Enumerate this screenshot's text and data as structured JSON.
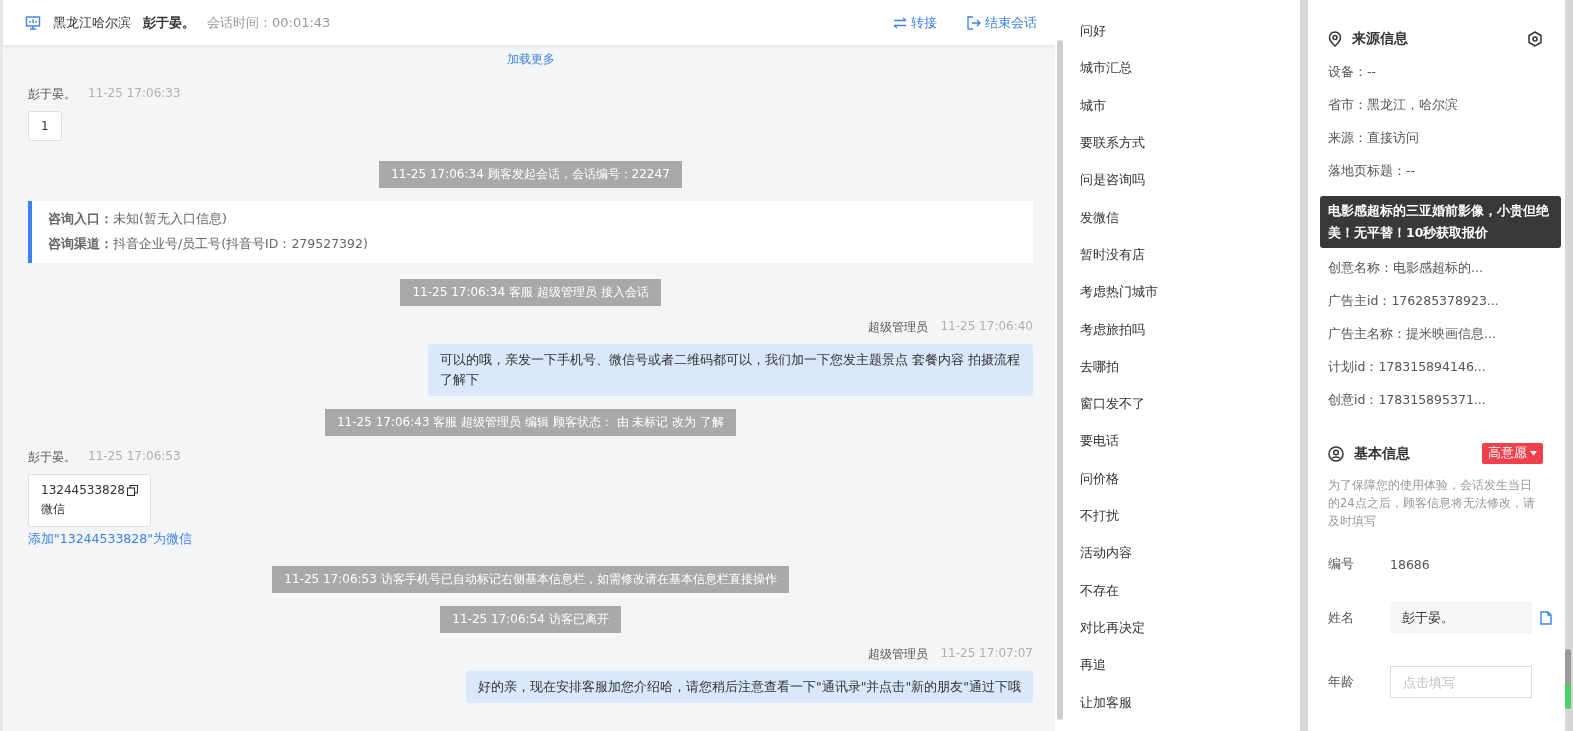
{
  "header": {
    "location": "黑龙江哈尔滨",
    "name": "彭于晏。",
    "duration_label": "会话时间：",
    "duration": "00:01:43",
    "actions": [
      {
        "kind": "transfer",
        "label": "转接"
      },
      {
        "kind": "end",
        "label": "结束会话"
      }
    ]
  },
  "chat": [
    {
      "kind": "load_more",
      "text": "加载更多"
    },
    {
      "kind": "visitor",
      "sender": "彭于晏。",
      "time": "11-25 17:06:33",
      "text": "1"
    },
    {
      "kind": "system",
      "text": "11-25 17:06:34 顾客发起会话，会话编号：22247"
    },
    {
      "kind": "info",
      "lines": [
        {
          "label": "咨询入口：",
          "value": "未知(暂无入口信息)"
        },
        {
          "label": "咨询渠道：",
          "value": "抖音企业号/员工号(抖音号ID：279527392)"
        }
      ]
    },
    {
      "kind": "system",
      "text": "11-25 17:06:34 客服 超级管理员 接入会话"
    },
    {
      "kind": "agent",
      "sender": "超级管理员",
      "time": "11-25 17:06:40",
      "text": "可以的哦，亲发一下手机号、微信号或者二维码都可以，我们加一下您发主题景点 套餐内容 拍摄流程了解下"
    },
    {
      "kind": "system",
      "text": "11-25 17:06:43 客服 超级管理员 编辑 顾客状态： 由 未标记 改为 了解"
    },
    {
      "kind": "contact",
      "sender": "彭于晏。",
      "time": "11-25 17:06:53",
      "phone": "13244533828",
      "type": "微信",
      "link": "添加\"13244533828\"为微信"
    },
    {
      "kind": "system",
      "text": "11-25 17:06:53 访客手机号已自动标记右侧基本信息栏，如需修改请在基本信息栏直接操作"
    },
    {
      "kind": "system",
      "text": "11-25 17:06:54 访客已离开"
    },
    {
      "kind": "agent",
      "sender": "超级管理员",
      "time": "11-25 17:07:07",
      "text": "好的亲，现在安排客服加您介绍哈，请您稍后注意查看一下\"通讯录\"并点击\"新的朋友\"通过下哦"
    }
  ],
  "quick_replies": [
    "问好",
    "城市汇总",
    "城市",
    "要联系方式",
    "问是咨询吗",
    "发微信",
    "暂时没有店",
    "考虑热门城市",
    "考虑旅拍吗",
    "去哪拍",
    "窗口发不了",
    "要电话",
    "问价格",
    "不打扰",
    "活动内容",
    "不存在",
    "对比再决定",
    "再追",
    "让加客服"
  ],
  "source_info": {
    "title": "来源信息",
    "rows": [
      {
        "kind": "row",
        "text": "设备：--"
      },
      {
        "kind": "row",
        "text": "省市：黑龙江，哈尔滨"
      },
      {
        "kind": "row",
        "text": "来源：直接访问"
      },
      {
        "kind": "row",
        "text": "落地页标题：--"
      },
      {
        "kind": "tooltip",
        "text": "电影感超标的三亚婚前影像，小贵但绝美！无平替！10秒获取报价"
      },
      {
        "kind": "row",
        "text": "创意名称：电影感超标的..."
      },
      {
        "kind": "row",
        "text": "广告主id：176285378923..."
      },
      {
        "kind": "row",
        "text": "广告主名称：提米映画信息..."
      },
      {
        "kind": "row",
        "text": "计划id：178315894146..."
      },
      {
        "kind": "row",
        "text": "创意id：178315895371..."
      }
    ]
  },
  "basic_info": {
    "title": "基本信息",
    "tag": "高意愿",
    "note": "为了保障您的使用体验，会话发生当日的24点之后，顾客信息将无法修改，请及时填写",
    "fields": [
      {
        "kind": "text",
        "label": "编号",
        "value": "18686"
      },
      {
        "kind": "filled",
        "label": "姓名",
        "value": "彭于晏。"
      },
      {
        "kind": "input",
        "label": "年龄",
        "placeholder": "点击填写"
      }
    ]
  }
}
